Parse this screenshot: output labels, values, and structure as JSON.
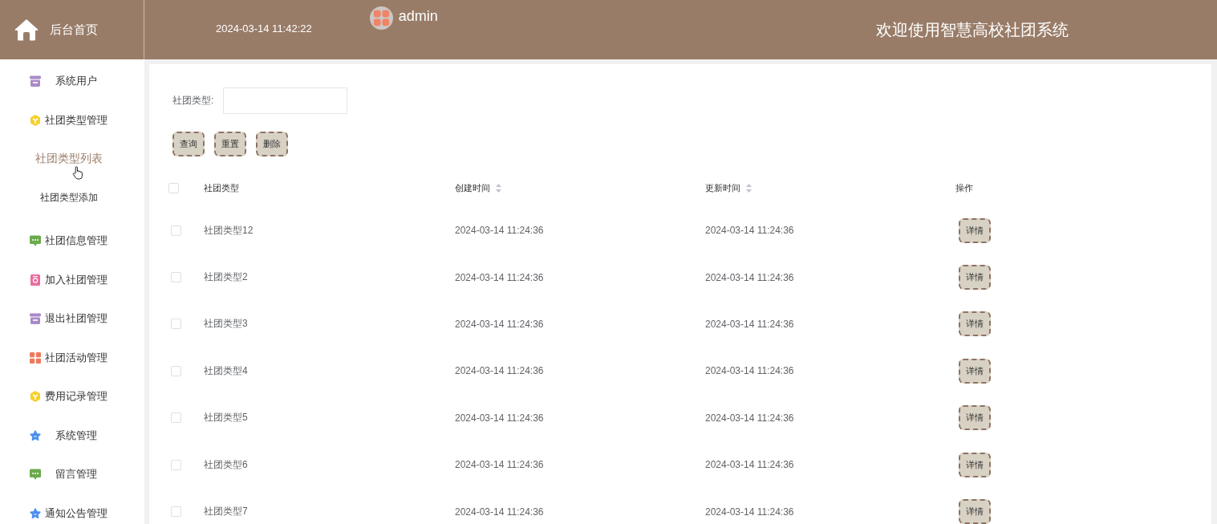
{
  "header": {
    "home_link": "后台首页",
    "datetime": "2024-03-14 11:42:22",
    "username": "admin",
    "title": "欢迎使用智慧高校社团系统"
  },
  "sidebar": {
    "items": [
      {
        "label": "系统用户",
        "selected": false
      },
      {
        "label": "社团类型管理",
        "selected": false,
        "children": [
          {
            "label": "社团类型列表",
            "selected": true
          },
          {
            "label": "社团类型添加",
            "selected": false
          }
        ]
      },
      {
        "label": "社团信息管理",
        "selected": false
      },
      {
        "label": "加入社团管理",
        "selected": false
      },
      {
        "label": "退出社团管理",
        "selected": false
      },
      {
        "label": "社团活动管理",
        "selected": false
      },
      {
        "label": "费用记录管理",
        "selected": false
      },
      {
        "label": "系统管理",
        "selected": false
      },
      {
        "label": "留言管理",
        "selected": false
      },
      {
        "label": "通知公告管理",
        "selected": false
      }
    ]
  },
  "search": {
    "label": "社团类型:"
  },
  "buttons": [
    "查询",
    "重置",
    "删除"
  ],
  "table": {
    "select_all_checked": false,
    "columns": [
      {
        "label": "社团类型",
        "sortable": false
      },
      {
        "label": "创建时间",
        "sortable": true
      },
      {
        "label": "更新时间",
        "sortable": true
      },
      {
        "label": "操作",
        "sortable": false
      }
    ],
    "rows": [
      {
        "checked": false,
        "cells": [
          "社团类型12",
          "2024-03-14 11:24:36",
          "2024-03-14 11:24:36"
        ],
        "action": "详情"
      },
      {
        "checked": false,
        "cells": [
          "社团类型2",
          "2024-03-14 11:24:36",
          "2024-03-14 11:24:36"
        ],
        "action": "详情"
      },
      {
        "checked": false,
        "cells": [
          "社团类型3",
          "2024-03-14 11:24:36",
          "2024-03-14 11:24:36"
        ],
        "action": "详情"
      },
      {
        "checked": false,
        "cells": [
          "社团类型4",
          "2024-03-14 11:24:36",
          "2024-03-14 11:24:36"
        ],
        "action": "详情"
      },
      {
        "checked": false,
        "cells": [
          "社团类型5",
          "2024-03-14 11:24:36",
          "2024-03-14 11:24:36"
        ],
        "action": "详情"
      },
      {
        "checked": false,
        "cells": [
          "社团类型6",
          "2024-03-14 11:24:36",
          "2024-03-14 11:24:36"
        ],
        "action": "详情"
      },
      {
        "checked": false,
        "cells": [
          "社团类型7",
          "2024-03-14 11:24:36",
          "2024-03-14 11:24:36"
        ],
        "action": "详情"
      }
    ]
  }
}
